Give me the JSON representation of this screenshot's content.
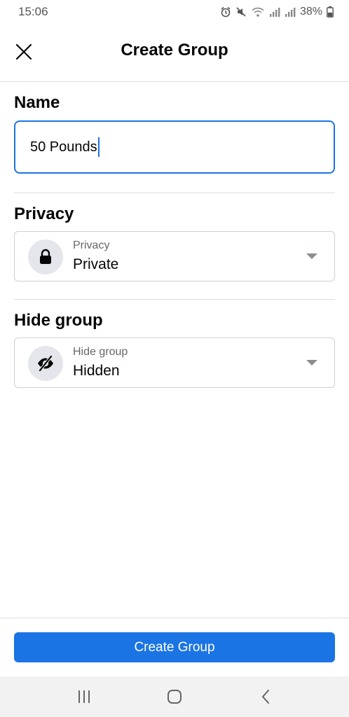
{
  "status_bar": {
    "time": "15:06",
    "battery": "38%",
    "icons": [
      "alarm-icon",
      "mute-icon",
      "wifi-icon",
      "signal-icon",
      "signal-icon",
      "battery-icon"
    ]
  },
  "header": {
    "title": "Create Group",
    "close_icon": "close-icon"
  },
  "form": {
    "name": {
      "label": "Name",
      "value": "50 Pounds"
    },
    "privacy": {
      "section_label": "Privacy",
      "field_label": "Privacy",
      "value": "Private",
      "icon": "lock-icon"
    },
    "hide_group": {
      "section_label": "Hide group",
      "field_label": "Hide group",
      "value": "Hidden",
      "icon": "eye-off-icon"
    }
  },
  "actions": {
    "create_label": "Create Group",
    "accent_color": "#1b74e4"
  },
  "nav_bar": {
    "icons": [
      "recent-apps-icon",
      "home-icon",
      "back-icon"
    ]
  }
}
